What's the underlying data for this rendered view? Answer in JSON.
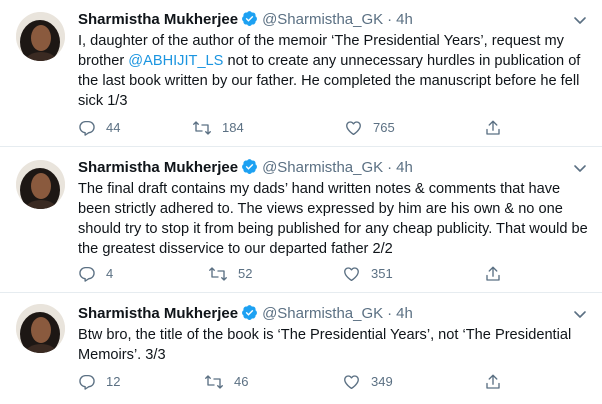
{
  "tweets": [
    {
      "name": "Sharmistha Mukherjee",
      "handle": "@Sharmistha_GK",
      "dot": "·",
      "time": "4h",
      "text_before": "I, daughter of the author of the memoir ‘The Presidential Years’, request my brother ",
      "mention": "@ABHIJIT_LS",
      "text_after": " not to create any unnecessary hurdles in publication of the last book written by our father. He completed the manuscript before he fell sick 1/3",
      "replies": "44",
      "retweets": "184",
      "likes": "765"
    },
    {
      "name": "Sharmistha Mukherjee",
      "handle": "@Sharmistha_GK",
      "dot": "·",
      "time": "4h",
      "text": "The final draft contains my dads’ hand written notes & comments that have been strictly adhered to. The views expressed by him are his own & no one should try to stop it from being published for any cheap publicity. That would be the greatest disservice to our departed father 2/2",
      "replies": "4",
      "retweets": "52",
      "likes": "351"
    },
    {
      "name": "Sharmistha Mukherjee",
      "handle": "@Sharmistha_GK",
      "dot": "·",
      "time": "4h",
      "text": "Btw bro, the title of the book is ‘The Presidential Years’, not ‘The Presidential Memoirs’. 3/3",
      "replies": "12",
      "retweets": "46",
      "likes": "349"
    }
  ],
  "icons": {
    "verified": "verified-badge-icon",
    "more": "chevron-down-icon",
    "reply": "reply-icon",
    "retweet": "retweet-icon",
    "like": "heart-icon",
    "share": "share-icon"
  },
  "colors": {
    "text": "#0f1419",
    "secondary": "#5b7083",
    "link": "#1b95e0",
    "verified": "#1da1f2",
    "separator": "#e6ecf0"
  }
}
